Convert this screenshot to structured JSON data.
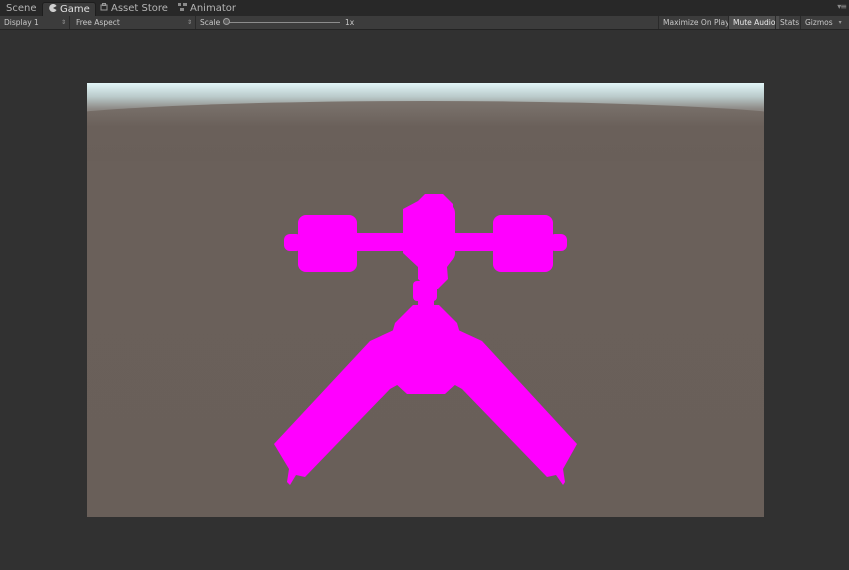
{
  "tabs": [
    {
      "label": "Scene",
      "icon": "",
      "active": false
    },
    {
      "label": "Game",
      "icon": "pacman-icon",
      "active": true
    },
    {
      "label": "Asset Store",
      "icon": "store-icon",
      "active": false
    },
    {
      "label": "Animator",
      "icon": "animator-icon",
      "active": false
    }
  ],
  "toolbar": {
    "display": "Display 1",
    "aspect": "Free Aspect",
    "scale_label": "Scale",
    "scale_value": "1x",
    "scale_level": 0.0,
    "maximize_on_play": "Maximize On Play",
    "mute_audio": "Mute Audio",
    "stats": "Stats",
    "gizmos": "Gizmos"
  },
  "colors": {
    "missing_material": "#ff00ff",
    "background": "#313131"
  }
}
